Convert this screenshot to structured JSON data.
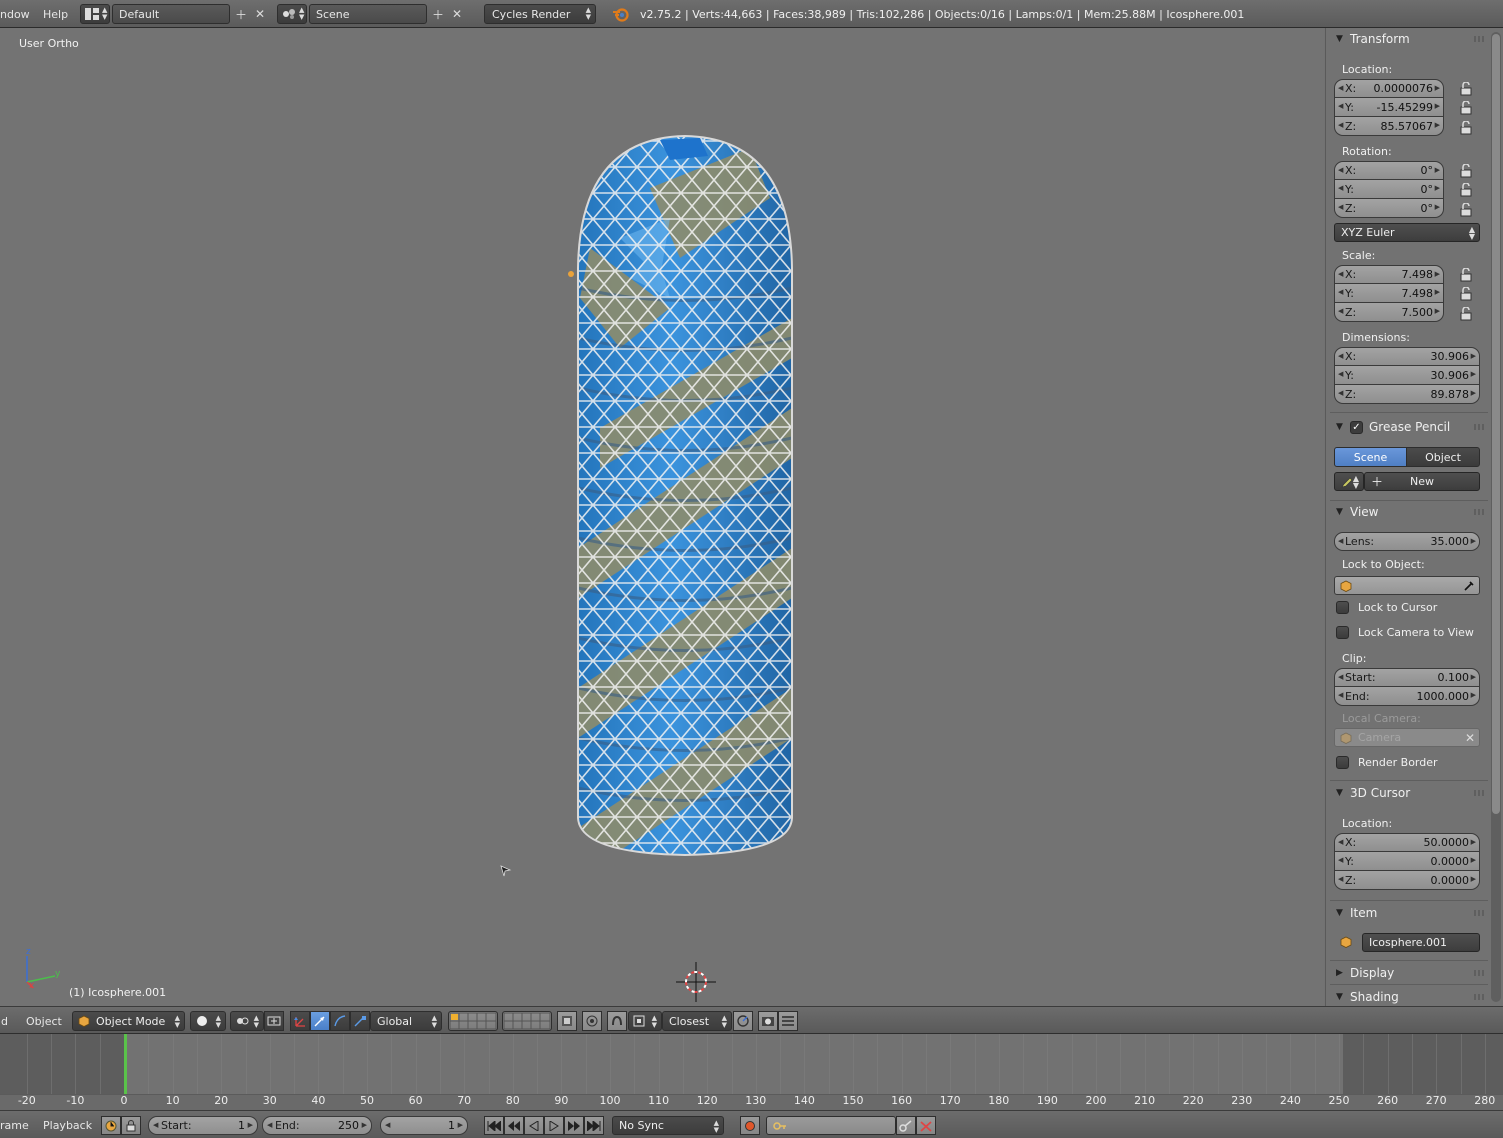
{
  "topbar": {
    "menu_window": "ndow",
    "menu_help": "Help",
    "screen_layout": "Default",
    "scene_name": "Scene",
    "render_engine": "Cycles Render",
    "stats": "v2.75.2 | Verts:44,663 | Faces:38,989 | Tris:102,286 | Objects:0/16 | Lamps:0/1 | Mem:25.88M | Icosphere.001"
  },
  "viewport": {
    "view_label": "User Ortho",
    "object_label": "(1) Icosphere.001",
    "axis_labels": {
      "z": "z",
      "y": "y",
      "x": "x"
    }
  },
  "sidebar": {
    "transform": {
      "title": "Transform",
      "location_label": "Location:",
      "location": [
        {
          "axis": "X:",
          "value": "0.0000076"
        },
        {
          "axis": "Y:",
          "value": "-15.45299"
        },
        {
          "axis": "Z:",
          "value": "85.57067"
        }
      ],
      "rotation_label": "Rotation:",
      "rotation": [
        {
          "axis": "X:",
          "value": "0°"
        },
        {
          "axis": "Y:",
          "value": "0°"
        },
        {
          "axis": "Z:",
          "value": "0°"
        }
      ],
      "rotation_mode": "XYZ Euler",
      "scale_label": "Scale:",
      "scale": [
        {
          "axis": "X:",
          "value": "7.498"
        },
        {
          "axis": "Y:",
          "value": "7.498"
        },
        {
          "axis": "Z:",
          "value": "7.500"
        }
      ],
      "dimensions_label": "Dimensions:",
      "dimensions": [
        {
          "axis": "X:",
          "value": "30.906"
        },
        {
          "axis": "Y:",
          "value": "30.906"
        },
        {
          "axis": "Z:",
          "value": "89.878"
        }
      ]
    },
    "grease_pencil": {
      "title": "Grease Pencil",
      "tab_scene": "Scene",
      "tab_object": "Object",
      "new_label": "New"
    },
    "view": {
      "title": "View",
      "lens_label": "Lens:",
      "lens_value": "35.000",
      "lock_object_label": "Lock to Object:",
      "lock_cursor": "Lock to Cursor",
      "lock_camera": "Lock Camera to View",
      "clip_label": "Clip:",
      "clip_start_label": "Start:",
      "clip_start": "0.100",
      "clip_end_label": "End:",
      "clip_end": "1000.000",
      "local_camera_label": "Local Camera:",
      "local_camera": "Camera",
      "render_border": "Render Border"
    },
    "cursor3d": {
      "title": "3D Cursor",
      "location_label": "Location:",
      "location": [
        {
          "axis": "X:",
          "value": "50.0000"
        },
        {
          "axis": "Y:",
          "value": "0.0000"
        },
        {
          "axis": "Z:",
          "value": "0.0000"
        }
      ]
    },
    "item": {
      "title": "Item",
      "name": "Icosphere.001"
    },
    "display": {
      "title": "Display"
    },
    "shading": {
      "title": "Shading"
    }
  },
  "header3d": {
    "menu_view_cut": "d",
    "menu_object": "Object",
    "mode": "Object Mode",
    "orientation": "Global",
    "snap_target": "Closest"
  },
  "timeline": {
    "ticks": [
      "-20",
      "-10",
      "0",
      "10",
      "20",
      "30",
      "40",
      "50",
      "60",
      "70",
      "80",
      "90",
      "100",
      "110",
      "120",
      "130",
      "140",
      "150",
      "160",
      "170",
      "180",
      "190",
      "200",
      "210",
      "220",
      "230",
      "240",
      "250",
      "260",
      "270",
      "280"
    ],
    "current_frame": 1
  },
  "timeline_header": {
    "menu_frame_cut": "rame",
    "menu_playback": "Playback",
    "start_label": "Start:",
    "start_value": "1",
    "end_label": "End:",
    "end_value": "250",
    "current_value": "1",
    "sync": "No Sync"
  },
  "colors": {
    "mesh_blue": "#2f86d6",
    "mesh_olive": "#8b8c6e",
    "wire": "#f2f2f2",
    "selected_tab": "#5680c2",
    "playhead": "#5ac24a"
  }
}
